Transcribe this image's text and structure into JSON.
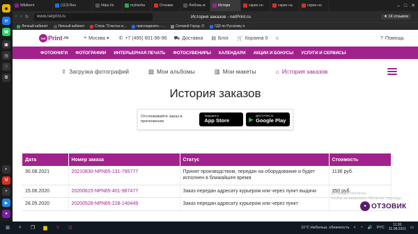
{
  "browser": {
    "tabs": [
      {
        "label": "Wildberri",
        "color": "#8b1e8f",
        "active": false
      },
      {
        "label": "(113) Вхо",
        "color": "#1a73e8",
        "active": false
      },
      {
        "label": "https://e",
        "color": "#555555",
        "active": false
      },
      {
        "label": "myHerba",
        "color": "#2ea44f",
        "active": false
      },
      {
        "label": "Отзовик",
        "color": "#d93025",
        "active": false
      },
      {
        "label": "Любовь м",
        "color": "#555555",
        "active": false
      },
      {
        "label": "Истори",
        "color": "#a1228d",
        "active": true
      },
      {
        "label": "скрин но",
        "color": "#d93025",
        "active": false
      },
      {
        "label": "скрин на",
        "color": "#d93025",
        "active": false
      },
      {
        "label": "скрин но",
        "color": "#d93025",
        "active": false
      }
    ],
    "url": "www.netprint.ru",
    "page_title": "История заказов - netPrint.ru",
    "reviews_badge": "★ 1К отзывов",
    "bookmarks": [
      "Личный кабинет",
      "Личный кабинет",
      "Стиль \"Счастье и...",
      "присоединить - ...",
      "Сетевой Город. О",
      "ГДЗ по Русскому я"
    ]
  },
  "site": {
    "logo_main": "net",
    "logo_accent": "Print",
    "logo_suffix": ".ru",
    "city": "Москва ▾",
    "phone": "+7 (495) 601-96-96",
    "delivery": "Доставка",
    "blog": "Блог",
    "cart": "Корзина 0",
    "help": "Помощь",
    "menu": [
      "ФОТОКНИГИ",
      "ФОТОГРАФИИ",
      "ИНТЕРЬЕРНАЯ ПЕЧАТЬ",
      "ФОТОСУВЕНИРЫ",
      "КАЛЕНДАРИ",
      "АКЦИИ И БОНУСЫ",
      "УСЛУГИ И СЕРВИСЫ"
    ],
    "subnav": {
      "upload": "Загрузка фотографий",
      "albums": "Мои альбомы",
      "layouts": "Мои макеты",
      "history": "История заказов"
    },
    "page_heading": "История заказов",
    "apps": {
      "text": "Отслеживайте заказ в приложении",
      "appstore_small": "Загрузите в",
      "appstore_big": "App Store",
      "gplay_small": "ДОСТУПНО В",
      "gplay_big": "Google Play"
    },
    "table": {
      "headers": [
        "Дата",
        "Номер заказа",
        "Статус",
        "Стоимость"
      ],
      "rows": [
        {
          "date": "30.08.2021",
          "number": "20210830-NPN65-131-785777",
          "status": "Принят производством, передан на оборудование и будет исполнен в ближайшее время",
          "cost": "1136 руб."
        },
        {
          "date": "15.06.2020",
          "number": "20200615-NPN65-401-987477",
          "status": "Заказ передан адресату курьером или через пункт выдачи",
          "cost": "350 руб."
        },
        {
          "date": "28.05.2020",
          "number": "20200528-NPN65-228-140449",
          "status": "Заказ передан адресату курьером или через пункт",
          "cost": ""
        }
      ]
    }
  },
  "watermark": {
    "line1": "Активация Windows",
    "line2": "Чтобы активировать Windows, перейди..."
  },
  "otzovik": "ОТЗОВИК",
  "taskbar": {
    "weather": "11°C  Небольш. облачность",
    "lang": "РУС",
    "time": "11:30",
    "date": "31.08.2021"
  }
}
